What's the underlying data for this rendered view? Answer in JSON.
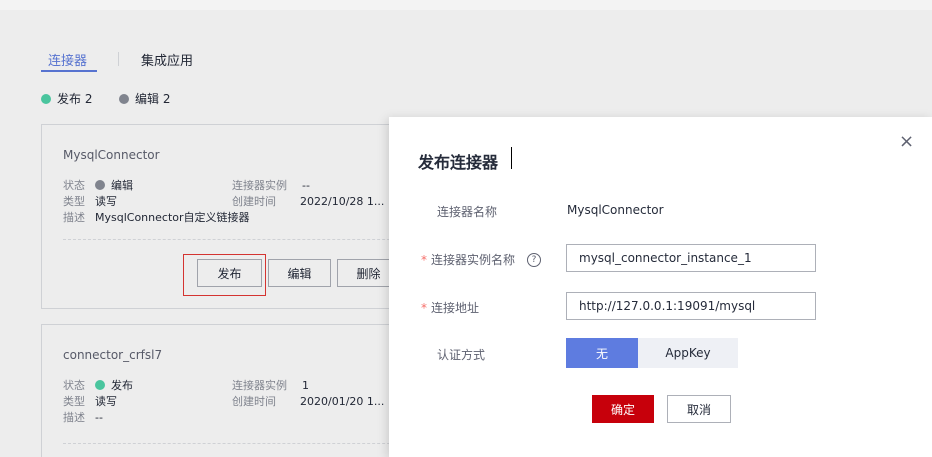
{
  "tabs": [
    {
      "label": "连接器",
      "active": true
    },
    {
      "label": "集成应用",
      "active": false
    }
  ],
  "stats": [
    {
      "label": "发布 2",
      "color": "#50d4ab"
    },
    {
      "label": "编辑 2",
      "color": "#8a8e99"
    }
  ],
  "cards": [
    {
      "title": "MysqlConnector",
      "status_label": "状态",
      "status": "编辑",
      "status_color": "#8a8e99",
      "type_label": "类型",
      "type": "读写",
      "desc_label": "描述",
      "desc": "MysqlConnector自定义链接器",
      "instance_label": "连接器实例",
      "instance": "--",
      "created_label": "创建时间",
      "created": "2022/10/28 1...",
      "buttons": [
        "发布",
        "编辑",
        "删除"
      ]
    },
    {
      "title": "connector_crfsl7",
      "status_label": "状态",
      "status": "发布",
      "status_color": "#50d4ab",
      "type_label": "类型",
      "type": "读写",
      "desc_label": "描述",
      "desc": "--",
      "instance_label": "连接器实例",
      "instance": "1",
      "created_label": "创建时间",
      "created": "2020/01/20 1..."
    }
  ],
  "modal": {
    "title": "发布连接器",
    "close_icon": "×",
    "name_label": "连接器名称",
    "name_value": "MysqlConnector",
    "instance_label": "连接器实例名称",
    "instance_value": "mysql_connector_instance_1",
    "help_icon": "?",
    "address_label": "连接地址",
    "address_value": "http://127.0.0.1:19091/mysql",
    "auth_label": "认证方式",
    "auth_options": [
      "无",
      "AppKey"
    ],
    "auth_selected": "无",
    "required_mark": "*",
    "ok_label": "确定",
    "cancel_label": "取消"
  }
}
